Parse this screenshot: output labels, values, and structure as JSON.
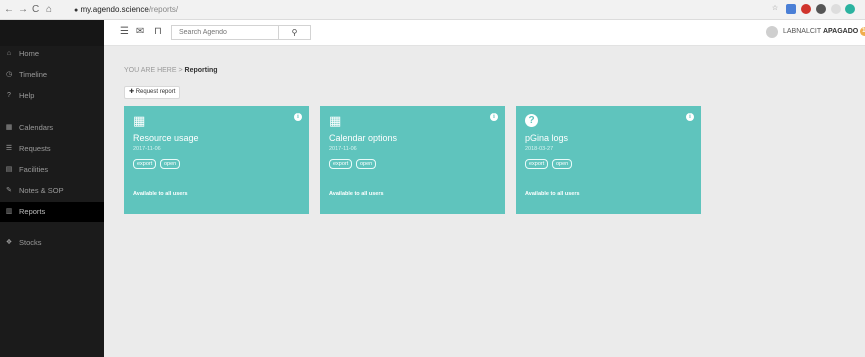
{
  "browser": {
    "url_host": "my.agendo.science",
    "url_path": "/reports/",
    "nav": {
      "back": "←",
      "forward": "→",
      "reload": "C",
      "home": "⌂",
      "lock": "🔒"
    }
  },
  "sidebar": {
    "items": [
      {
        "label": "Home",
        "icon": "home-icon",
        "glyph": "⌂"
      },
      {
        "label": "Timeline",
        "icon": "clock-icon",
        "glyph": "◷"
      },
      {
        "label": "Help",
        "icon": "help-icon",
        "glyph": "?"
      },
      {
        "label": "Calendars",
        "icon": "calendar-icon",
        "glyph": "▦"
      },
      {
        "label": "Requests",
        "icon": "list-icon",
        "glyph": "☰"
      },
      {
        "label": "Facilities",
        "icon": "grid-icon",
        "glyph": "▤"
      },
      {
        "label": "Notes & SOP",
        "icon": "edit-icon",
        "glyph": "✎"
      },
      {
        "label": "Reports",
        "icon": "bar-chart-icon",
        "glyph": "▥",
        "active": true
      },
      {
        "label": "Stocks",
        "icon": "cubes-icon",
        "glyph": "❖"
      }
    ]
  },
  "topbar": {
    "search_placeholder": "Search Agendo",
    "search_button": "🔍",
    "user_prefix": "LABNALCIT",
    "user_bold": "APAGADO",
    "user_badge": "16"
  },
  "breadcrumb": {
    "prefix": "YOU ARE HERE",
    "separator": ">",
    "current": "Reporting"
  },
  "request_button": "✚ Request report",
  "cards": [
    {
      "title": "Resource usage",
      "date": "2017-11-06",
      "export": "export",
      "open": "open",
      "availability": "Available to all users",
      "icon": "calendar-icon",
      "glyph": "▦"
    },
    {
      "title": "Calendar options",
      "date": "2017-11-06",
      "export": "export",
      "open": "open",
      "availability": "Available to all users",
      "icon": "calendar-icon",
      "glyph": "▦"
    },
    {
      "title": "pGina logs",
      "date": "2018-03-27",
      "export": "export",
      "open": "open",
      "availability": "Available to all users",
      "icon": "question-icon",
      "glyph": "?"
    }
  ],
  "colors": {
    "card": "#5fc4bd",
    "sidebar": "#1b1b1b",
    "background": "#ebebeb",
    "badge": "#f0ad4e"
  }
}
